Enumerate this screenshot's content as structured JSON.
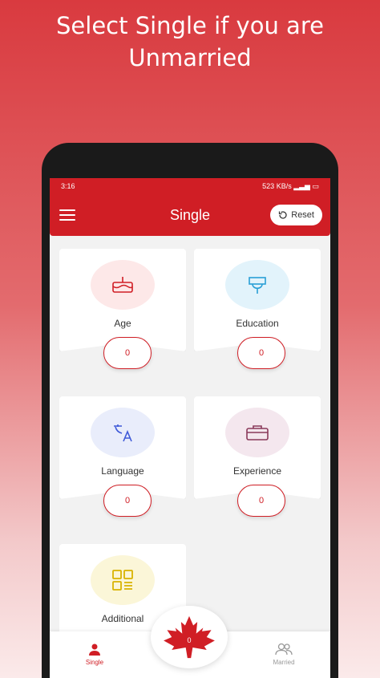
{
  "headline": {
    "line1": "Select Single if you are",
    "line2": "Unmarried"
  },
  "status_bar": {
    "time": "3:16",
    "right": "523 KB/s"
  },
  "app_bar": {
    "title": "Single",
    "reset_label": "Reset"
  },
  "cards": [
    {
      "label": "Age",
      "value": "0",
      "icon": "birthday-cake-icon",
      "bg": "#fde8e8",
      "color": "#d01e25"
    },
    {
      "label": "Education",
      "value": "0",
      "icon": "graduation-icon",
      "bg": "#e2f3fb",
      "color": "#2a9fd6"
    },
    {
      "label": "Language",
      "value": "0",
      "icon": "translate-icon",
      "bg": "#e9edfb",
      "color": "#3f5ad8"
    },
    {
      "label": "Experience",
      "value": "0",
      "icon": "briefcase-icon",
      "bg": "#f4e7ee",
      "color": "#8a3a5a"
    },
    {
      "label": "Additional",
      "value": "",
      "icon": "qr-code-icon",
      "bg": "#fbf6d8",
      "color": "#d9b300"
    }
  ],
  "bottom_nav": {
    "single_label": "Single",
    "married_label": "Married",
    "fab_count": "0"
  },
  "colors": {
    "accent": "#d01e25",
    "background_top": "#d93a3f"
  }
}
